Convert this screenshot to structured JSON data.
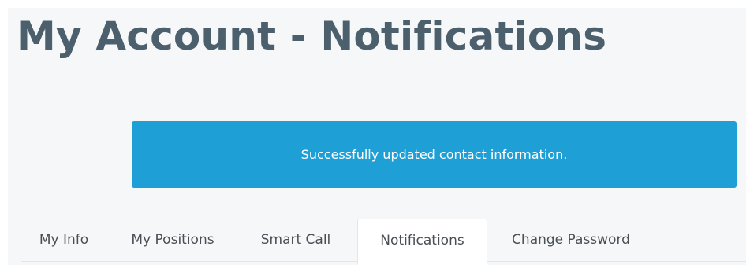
{
  "page": {
    "title": "My Account - Notifications"
  },
  "alert": {
    "message": "Successfully updated contact information.",
    "color": "#1e9fd6"
  },
  "tabs": [
    {
      "label": "My Info",
      "active": false
    },
    {
      "label": "My Positions",
      "active": false
    },
    {
      "label": "Smart Call",
      "active": false
    },
    {
      "label": "Notifications",
      "active": true
    },
    {
      "label": "Change Password",
      "active": false
    }
  ],
  "colors": {
    "title": "#4b5f6c",
    "background": "#f6f7f9",
    "tab_text": "#4a4f55"
  }
}
